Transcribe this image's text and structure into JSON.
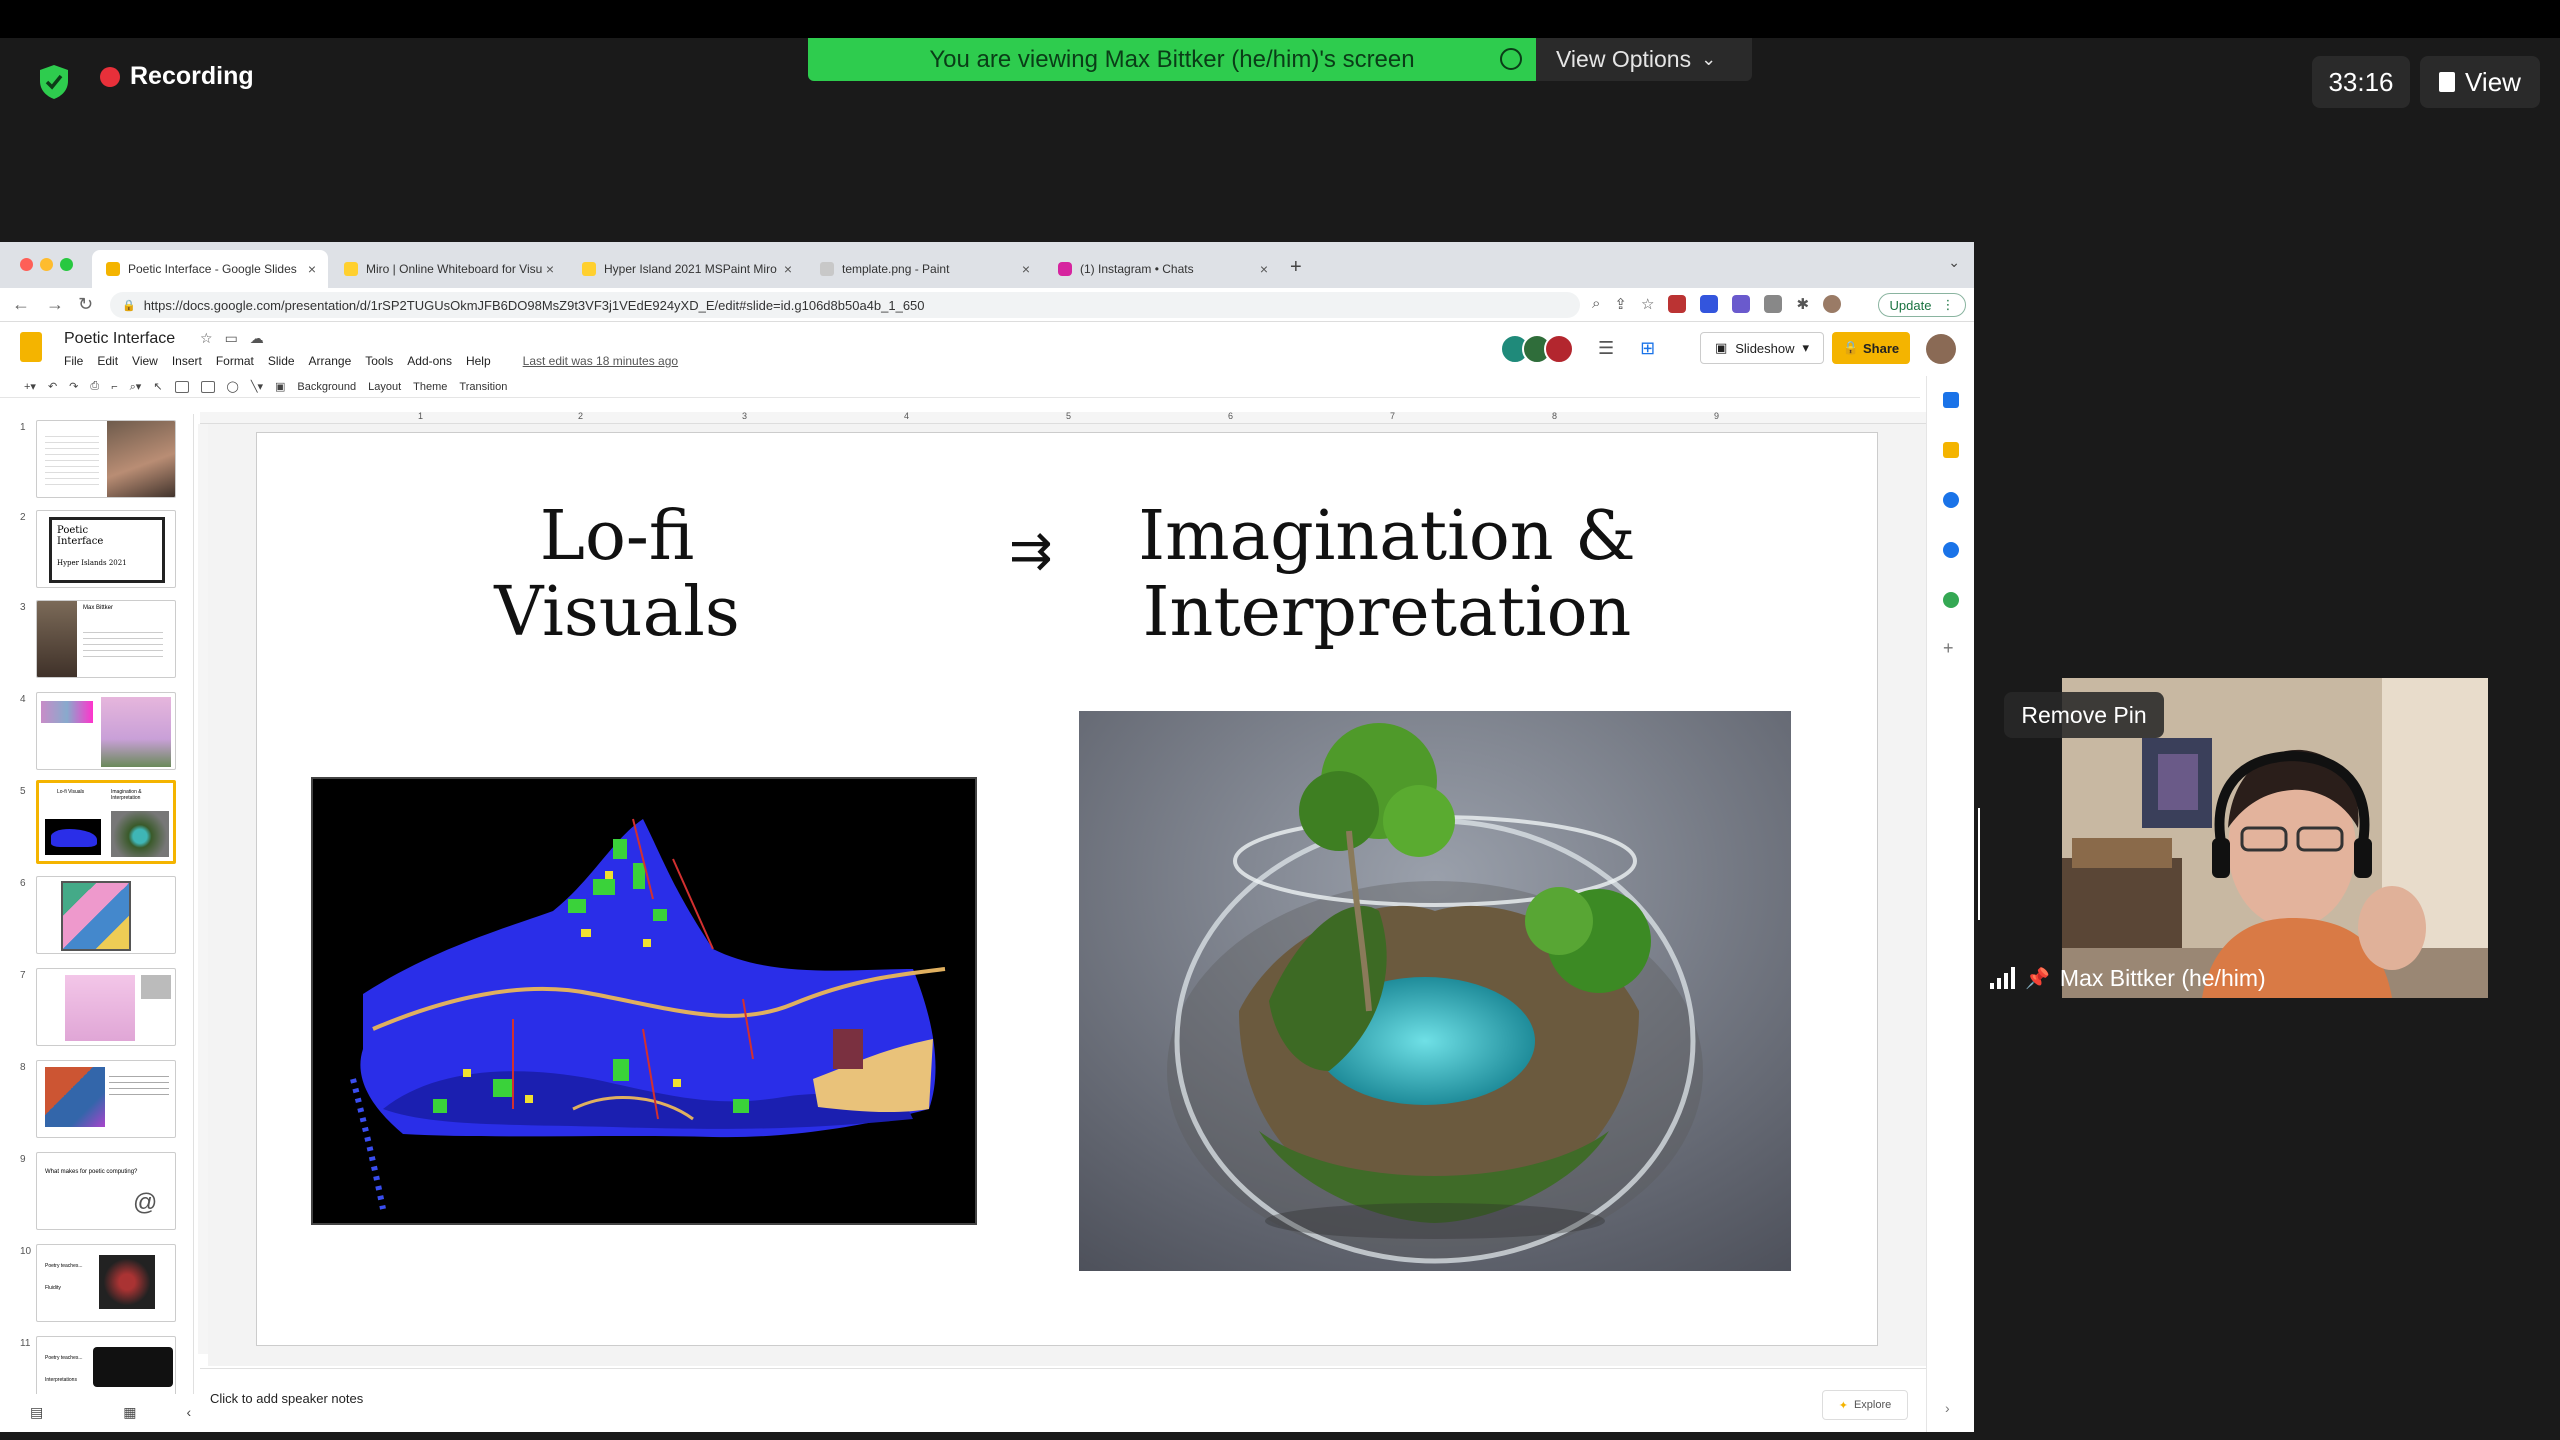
{
  "zoom": {
    "recording_label": "Recording",
    "viewing_banner": "You are viewing Max Bittker (he/him)'s screen",
    "view_options_label": "View Options",
    "timer": "33:16",
    "view_label": "View",
    "remove_pin_label": "Remove Pin",
    "participant_name": "Max Bittker (he/him)",
    "colors": {
      "banner": "#2ecc4e",
      "record": "#e8303a"
    }
  },
  "browser": {
    "tabs": [
      {
        "title": "Poetic Interface - Google Slides",
        "active": true
      },
      {
        "title": "Miro | Online Whiteboard for Visual Collaboration"
      },
      {
        "title": "Hyper Island 2021 MSPaint Miro"
      },
      {
        "title": "template.png - Paint"
      },
      {
        "title": "(1) Instagram • Chats"
      }
    ],
    "url": "https://docs.google.com/presentation/d/1rSP2TUGUsOkmJFB6DO98MsZ9t3VF3j1VEdE924yXD_E/edit#slide=id.g106d8b50a4b_1_650",
    "update_label": "Update"
  },
  "slides_app": {
    "doc_title": "Poetic Interface",
    "menus": [
      "File",
      "Edit",
      "View",
      "Insert",
      "Format",
      "Slide",
      "Arrange",
      "Tools",
      "Add-ons",
      "Help"
    ],
    "last_edit": "Last edit was 18 minutes ago",
    "slideshow_label": "Slideshow",
    "share_label": "Share",
    "toolbar": {
      "background": "Background",
      "layout": "Layout",
      "theme": "Theme",
      "transition": "Transition"
    },
    "ruler_numbers": [
      "1",
      "2",
      "3",
      "4",
      "5",
      "6",
      "7",
      "8",
      "9"
    ],
    "slide_numbers": [
      "1",
      "2",
      "3",
      "4",
      "5",
      "6",
      "7",
      "8",
      "9",
      "10",
      "11"
    ],
    "thumb_texts": {
      "t2_title": "Poetic Interface",
      "t2_sub": "Hyper Islands 2021",
      "t3_name": "Max Bittker",
      "t5_left": "Lo-fi Visuals",
      "t5_right": "Imagination & Interpretation",
      "t9_question": "What makes for poetic computing?",
      "t10_a": "Poetry teaches...",
      "t10_b": "Fluidity",
      "t11_a": "Poetry teaches...",
      "t11_b": "Interpretations"
    },
    "slide": {
      "left_heading": "Lo-fi Visuals",
      "arrow": "⇉",
      "right_heading": "Imagination & Interpretation"
    },
    "speaker_notes_placeholder": "Click to add speaker notes",
    "explore_label": "Explore"
  }
}
